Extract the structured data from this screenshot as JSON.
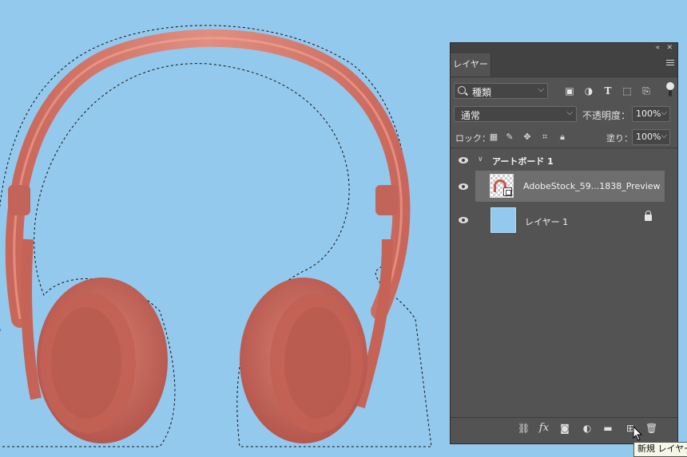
{
  "panel": {
    "tab_label": "レイヤー",
    "filter": {
      "kind_label": "種類"
    },
    "blend": {
      "mode": "通常",
      "opacity_label": "不透明度：",
      "opacity_value": "100%"
    },
    "lock": {
      "label": "ロック：",
      "fill_label": "塗り：",
      "fill_value": "100%"
    },
    "layers": [
      {
        "name": "アートボード 1",
        "type": "artboard",
        "visible": true,
        "expanded": true
      },
      {
        "name": "AdobeStock_59...1838_Preview",
        "type": "smart-object",
        "visible": true,
        "selected": true
      },
      {
        "name": "レイヤー 1",
        "type": "pixel",
        "visible": true,
        "locked": true
      }
    ]
  },
  "tooltip": {
    "text": "新規 レイヤー"
  },
  "colors": {
    "canvas_bg": "#94c9ee",
    "headphone": "#d67a6c",
    "panel_bg": "#535353",
    "selected_row": "#6e6e6e"
  }
}
